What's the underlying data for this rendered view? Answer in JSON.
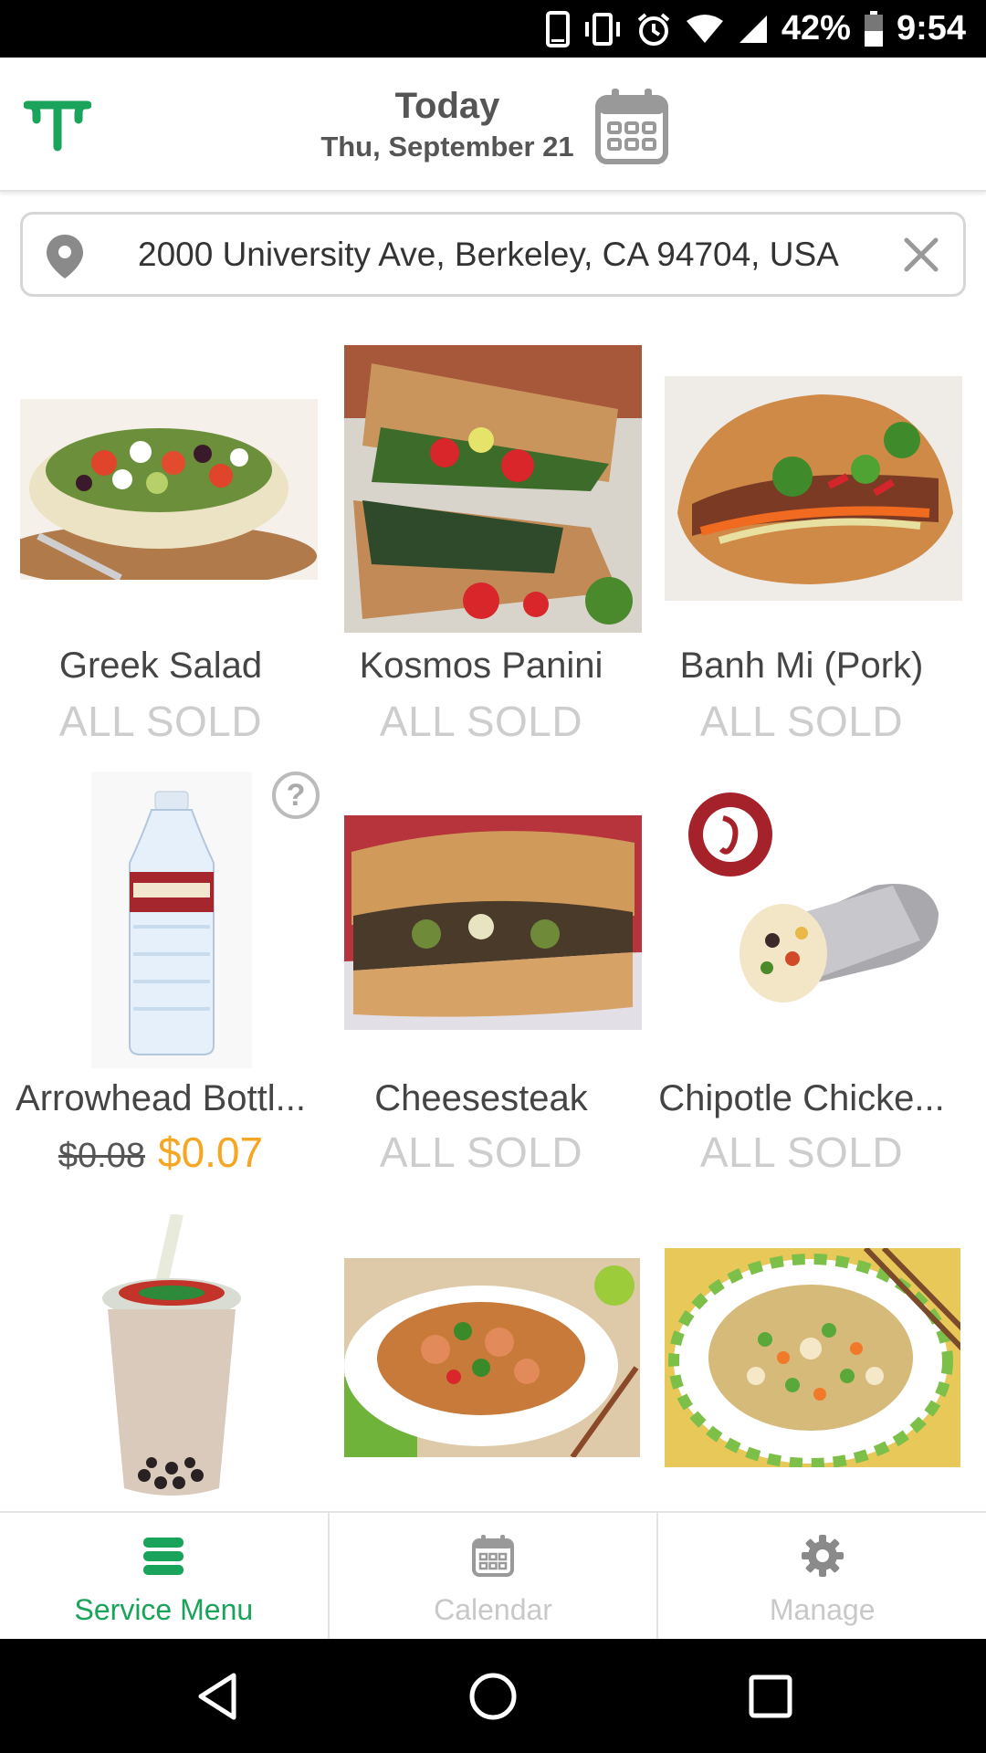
{
  "status_bar": {
    "battery": "42%",
    "time": "9:54"
  },
  "header": {
    "title": "Today",
    "date": "Thu, September 21"
  },
  "address": {
    "value": "2000 University Ave, Berkeley, CA 94704, USA"
  },
  "menu": {
    "items": [
      {
        "name": "Greek Salad",
        "status": "ALL SOLD"
      },
      {
        "name": "Kosmos Panini",
        "status": "ALL SOLD"
      },
      {
        "name": "Banh Mi (Pork)",
        "status": "ALL SOLD"
      },
      {
        "name": "Arrowhead Bottl...",
        "price_old": "$0.08",
        "price_new": "$0.07",
        "help": "?"
      },
      {
        "name": "Cheesesteak",
        "status": "ALL SOLD"
      },
      {
        "name": "Chipotle Chicke...",
        "status": "ALL SOLD"
      },
      {
        "name": "",
        "status": ""
      },
      {
        "name": "",
        "status": ""
      },
      {
        "name": "",
        "status": ""
      }
    ]
  },
  "bottom_nav": {
    "tabs": [
      {
        "label": "Service Menu",
        "icon": "menu-stack-icon",
        "active": true
      },
      {
        "label": "Calendar",
        "icon": "calendar-icon",
        "active": false
      },
      {
        "label": "Manage",
        "icon": "gear-icon",
        "active": false
      }
    ]
  },
  "colors": {
    "brand_green": "#1aa35a",
    "price_orange": "#f5a623",
    "sold_gray": "#cdcdcd"
  }
}
